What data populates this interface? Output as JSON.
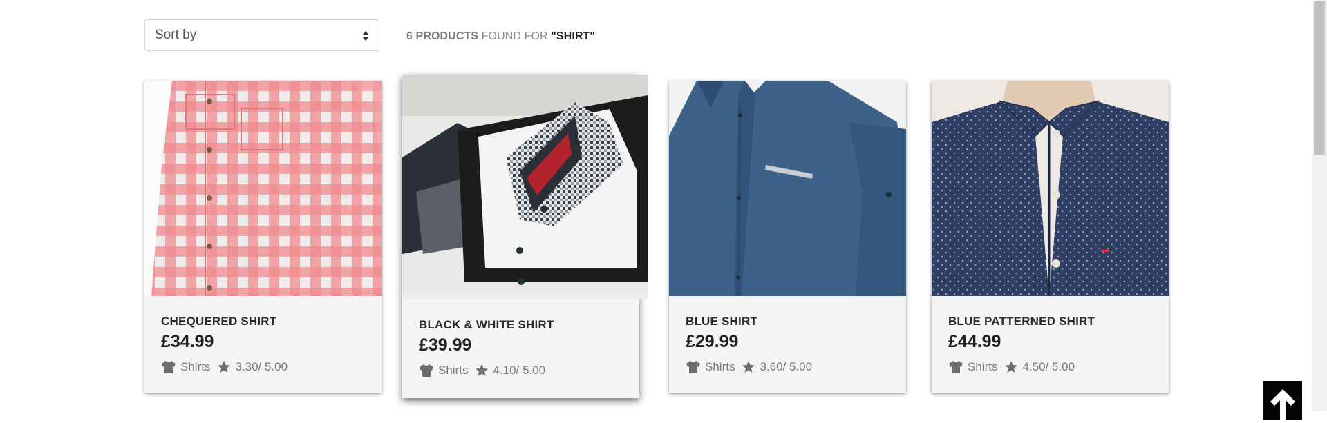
{
  "sort": {
    "label": "Sort by"
  },
  "results": {
    "count_text": "6 PRODUCTS",
    "middle_text": " FOUND FOR ",
    "query_text": "\"SHIRT\""
  },
  "products": [
    {
      "name": "CHEQUERED SHIRT",
      "price": "£34.99",
      "category": "Shirts",
      "rating": "3.30/ 5.00"
    },
    {
      "name": "BLACK & WHITE SHIRT",
      "price": "£39.99",
      "category": "Shirts",
      "rating": "4.10/ 5.00"
    },
    {
      "name": "BLUE SHIRT",
      "price": "£29.99",
      "category": "Shirts",
      "rating": "3.60/ 5.00"
    },
    {
      "name": "BLUE PATTERNED SHIRT",
      "price": "£44.99",
      "category": "Shirts",
      "rating": "4.50/ 5.00"
    }
  ],
  "icons": {
    "category": "tshirt-icon",
    "rating": "star-icon",
    "scroll_top": "arrow-up-icon",
    "sort": "sort-arrows-icon"
  },
  "colors": {
    "card_bg": "#f4f4f4",
    "scroll_button": "#050505",
    "muted_text": "#7a7a7a"
  }
}
